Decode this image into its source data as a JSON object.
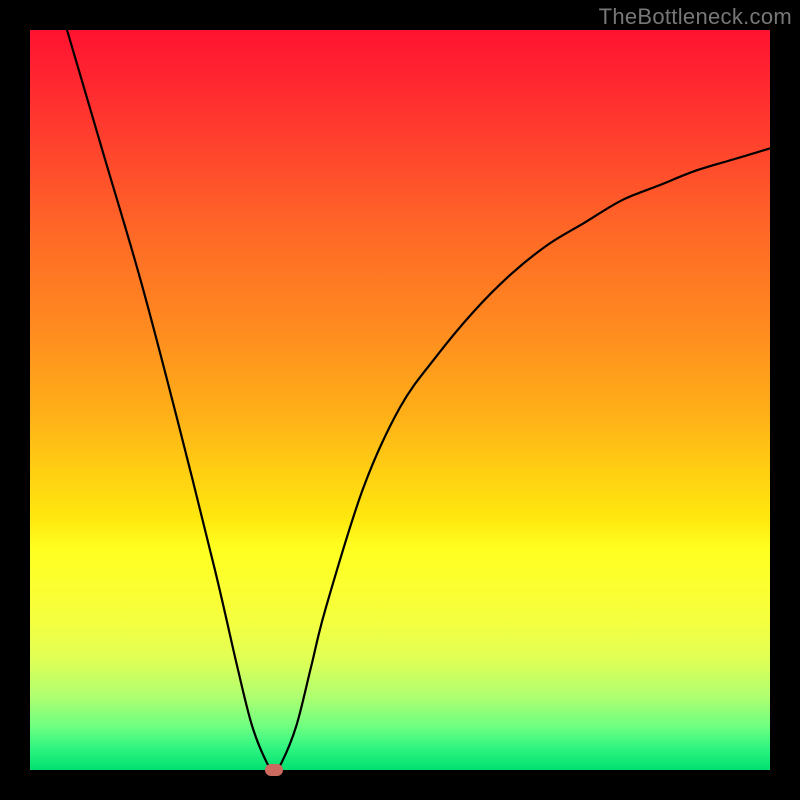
{
  "watermark": "TheBottleneck.com",
  "chart_data": {
    "type": "line",
    "title": "",
    "xlabel": "",
    "ylabel": "",
    "xlim": [
      0,
      100
    ],
    "ylim": [
      0,
      100
    ],
    "grid": false,
    "legend": false,
    "series": [
      {
        "name": "bottleneck-curve",
        "color": "#000000",
        "x": [
          5,
          10,
          15,
          20,
          25,
          28,
          30,
          32,
          33,
          34,
          36,
          38,
          40,
          45,
          50,
          55,
          60,
          65,
          70,
          75,
          80,
          85,
          90,
          95,
          100
        ],
        "y": [
          100,
          83,
          66,
          47,
          27,
          14,
          6,
          1,
          0,
          1,
          6,
          14,
          22,
          38,
          49,
          56,
          62,
          67,
          71,
          74,
          77,
          79,
          81,
          82.5,
          84
        ]
      }
    ],
    "annotations": [
      {
        "name": "min-point",
        "x": 33,
        "y": 0,
        "color": "#cc6a60"
      }
    ]
  }
}
